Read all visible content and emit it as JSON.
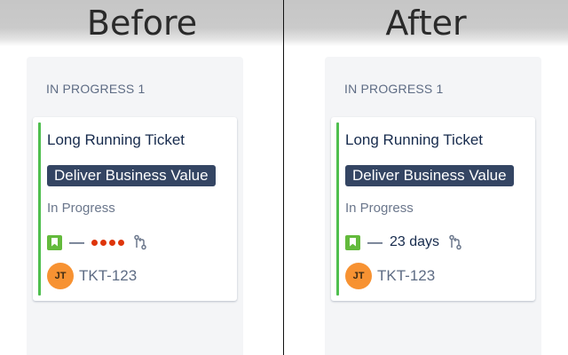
{
  "panels": [
    {
      "banner_label": "Before",
      "column_header": "IN PROGRESS 1",
      "card": {
        "title": "Long Running Ticket",
        "epic": "Deliver Business Value",
        "status": "In Progress",
        "issue_type_icon": "story-icon",
        "estimate": "—",
        "days_in_column_dots": 4,
        "dot_color": "#de350b",
        "pr_icon": "pull-request-icon",
        "avatar_initials": "JT",
        "key": "TKT-123"
      }
    },
    {
      "banner_label": "After",
      "column_header": "IN PROGRESS 1",
      "card": {
        "title": "Long Running Ticket",
        "epic": "Deliver Business Value",
        "status": "In Progress",
        "issue_type_icon": "story-icon",
        "estimate": "—",
        "days_in_column": "23 days",
        "pr_icon": "pull-request-icon",
        "avatar_initials": "JT",
        "key": "TKT-123"
      }
    }
  ],
  "colors": {
    "accent_green": "#4fbf4f",
    "epic_bg": "#344563",
    "avatar_bg": "#f79232",
    "column_bg": "#f4f5f7"
  }
}
